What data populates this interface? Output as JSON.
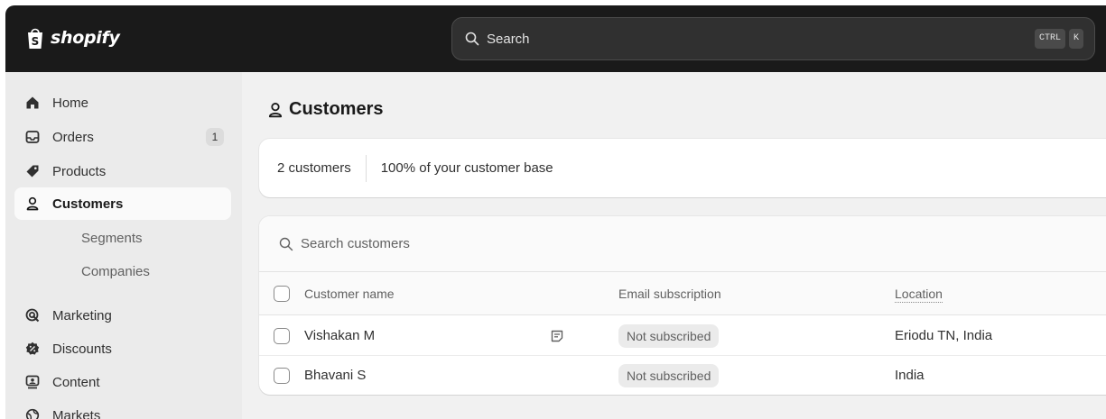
{
  "brand": {
    "name": "shopify"
  },
  "search": {
    "label": "Search",
    "shortcut": [
      "CTRL",
      "K"
    ]
  },
  "sidebar": {
    "items": [
      {
        "label": "Home",
        "icon": "home-icon"
      },
      {
        "label": "Orders",
        "icon": "orders-icon",
        "badge": "1"
      },
      {
        "label": "Products",
        "icon": "tag-icon"
      },
      {
        "label": "Customers",
        "icon": "person-icon",
        "active": true
      },
      {
        "label": "Segments",
        "sub": true
      },
      {
        "label": "Companies",
        "sub": true
      },
      {
        "label": "Marketing",
        "icon": "target-icon"
      },
      {
        "label": "Discounts",
        "icon": "discount-icon"
      },
      {
        "label": "Content",
        "icon": "content-icon"
      },
      {
        "label": "Markets",
        "icon": "globe-icon"
      }
    ]
  },
  "page": {
    "title": "Customers"
  },
  "stats": {
    "count": "2 customers",
    "share": "100% of your customer base"
  },
  "table": {
    "search_placeholder": "Search customers",
    "columns": [
      "Customer name",
      "Email subscription",
      "Location"
    ],
    "rows": [
      {
        "name": "Vishakan M",
        "has_note": true,
        "subscription": "Not subscribed",
        "location": "Eriodu TN, India"
      },
      {
        "name": "Bhavani S",
        "has_note": false,
        "subscription": "Not subscribed",
        "location": "India"
      }
    ]
  },
  "colors": {
    "topbar": "#1a1a1a",
    "sidebar": "#ebebeb",
    "background": "#f1f1f1",
    "card": "#ffffff",
    "pill": "#ebebeb"
  }
}
